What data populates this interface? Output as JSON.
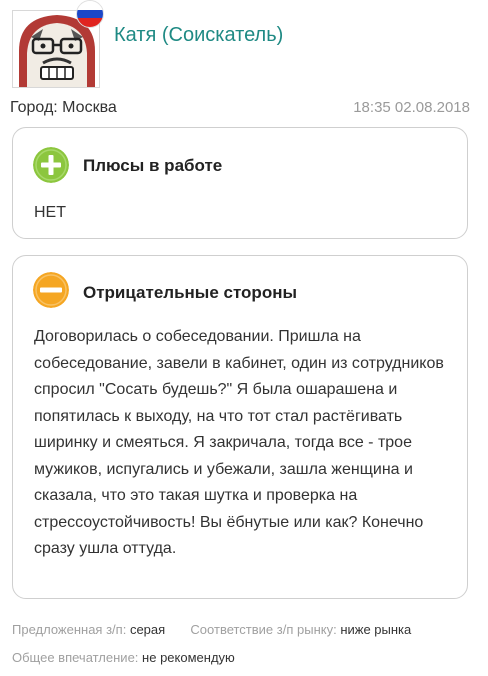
{
  "user": {
    "name": "Катя (Соискатель)",
    "city": "Город: Москва",
    "datetime": "18:35 02.08.2018",
    "flag_colors": [
      "#ffffff",
      "#1c47c7",
      "#e0241f"
    ]
  },
  "pros": {
    "title": "Плюсы в работе",
    "text": "НЕТ",
    "icon": "plus-circle-icon",
    "icon_color": "#8cc63e"
  },
  "cons": {
    "title": "Отрицательные стороны",
    "text": "Договорилась о собеседовании. Пришла на собеседование, завели в кабинет, один из сотрудников спросил \"Сосать будешь?\" Я была ошарашена и попятилась к выходу, на что тот стал растёгивать ширинку и смеяться. Я закричала, тогда все - трое мужиков, испугались и убежали, зашла женщина и сказала, что это такая шутка и проверка на стрессоустойчивость! Вы ёбнутые или как? Конечно сразу ушла оттуда.",
    "icon": "minus-circle-icon",
    "icon_color": "#f5a623"
  },
  "footer": {
    "salary_label": "Предложенная з/п:",
    "salary_value": "серая",
    "market_label": "Соответствие з/п рынку:",
    "market_value": "ниже рынка",
    "impression_label": "Общее впечатление:",
    "impression_value": "не рекомендую"
  }
}
